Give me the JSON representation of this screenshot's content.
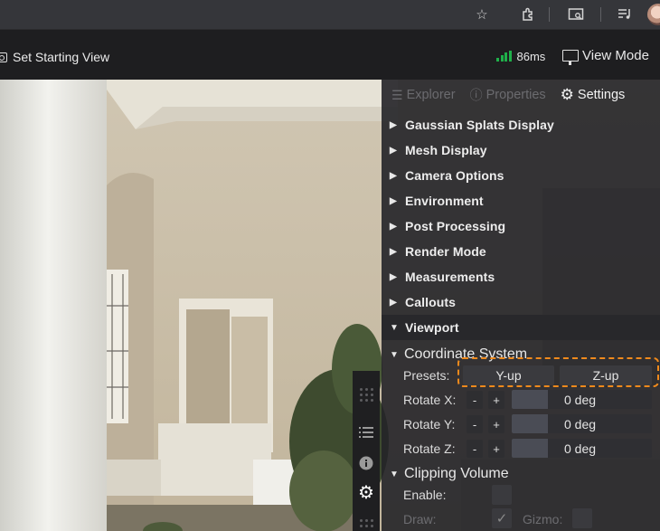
{
  "browser": {
    "icons": [
      "star-icon",
      "extensions-icon",
      "cast-icon",
      "media-queue-icon"
    ]
  },
  "toolbar": {
    "set_starting_view": "Set Starting View",
    "latency": "86ms",
    "view_mode": "View Mode"
  },
  "panel": {
    "tabs": [
      {
        "label": "Explorer",
        "icon": "list-icon",
        "active": false
      },
      {
        "label": "Properties",
        "icon": "info-icon",
        "active": false
      },
      {
        "label": "Settings",
        "icon": "gear-icon",
        "active": true
      }
    ],
    "sections": [
      {
        "label": "Gaussian Splats Display",
        "open": false
      },
      {
        "label": "Mesh Display",
        "open": false
      },
      {
        "label": "Camera Options",
        "open": false
      },
      {
        "label": "Environment",
        "open": false
      },
      {
        "label": "Post Processing",
        "open": false
      },
      {
        "label": "Render Mode",
        "open": false
      },
      {
        "label": "Measurements",
        "open": false
      },
      {
        "label": "Callouts",
        "open": false
      },
      {
        "label": "Viewport",
        "open": true
      }
    ],
    "viewport": {
      "coordinate_system": {
        "title": "Coordinate System",
        "presets_label": "Presets:",
        "presets": [
          "Y-up",
          "Z-up"
        ],
        "rotations": [
          {
            "label": "Rotate X:",
            "value": "0 deg"
          },
          {
            "label": "Rotate Y:",
            "value": "0 deg"
          },
          {
            "label": "Rotate Z:",
            "value": "0 deg"
          }
        ],
        "minus": "-",
        "plus": "+"
      },
      "clipping_volume": {
        "title": "Clipping Volume",
        "enable_label": "Enable:",
        "draw_label": "Draw:",
        "gizmo_label": "Gizmo:"
      }
    }
  },
  "colors": {
    "accent_highlight": "#f08a1c",
    "signal_green": "#1fb04a",
    "panel_bg": "#242428"
  }
}
